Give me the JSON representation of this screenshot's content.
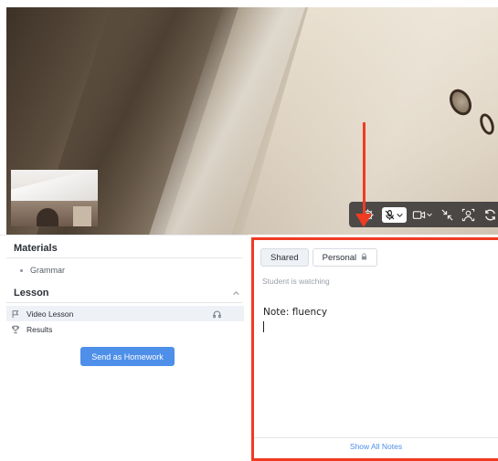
{
  "video": {
    "toolbar": {
      "icons": [
        "gear-icon",
        "mic-muted-icon",
        "chevron-down-icon",
        "camera-icon",
        "chevron-down-icon",
        "minimize-icon",
        "screen-share-icon",
        "refresh-icon"
      ]
    },
    "annotation_color": "#f03a22"
  },
  "materials": {
    "title": "Materials",
    "items": [
      {
        "label": "Grammar"
      }
    ]
  },
  "lesson": {
    "title": "Lesson",
    "items": [
      {
        "label": "Video Lesson",
        "icon": "flag-icon",
        "active": true,
        "trailing_icon": "headphones-icon"
      },
      {
        "label": "Results",
        "icon": "trophy-icon",
        "active": false
      }
    ],
    "homework_button": "Send as Homework"
  },
  "notes": {
    "tabs": [
      {
        "label": "Shared",
        "active": true
      },
      {
        "label": "Personal",
        "active": false,
        "icon": "lock-icon"
      }
    ],
    "status": "Student is watching",
    "content": "Note: fluency",
    "footer_link": "Show All Notes"
  },
  "colors": {
    "accent": "#4d8fe9",
    "highlight": "#f03a22"
  }
}
